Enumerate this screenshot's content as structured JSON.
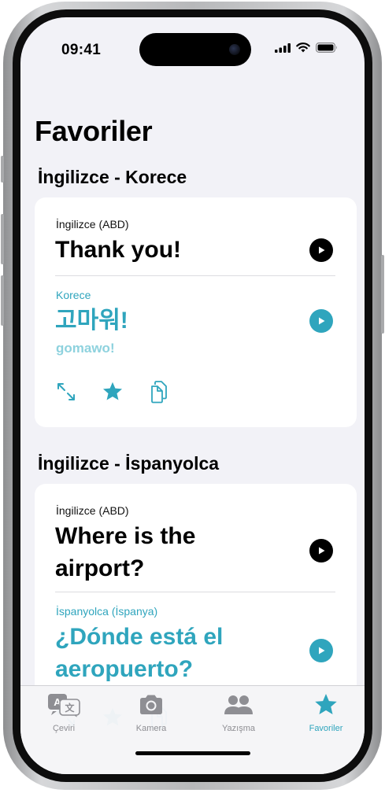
{
  "status_bar": {
    "time": "09:41"
  },
  "page": {
    "title": "Favoriler"
  },
  "favorites": [
    {
      "section_title": "İngilizce - Korece",
      "source_language": "İngilizce (ABD)",
      "source_text": "Thank you!",
      "target_language": "Korece",
      "target_text": "고마워!",
      "transliteration": "gomawo!"
    },
    {
      "section_title": "İngilizce - İspanyolca",
      "source_language": "İngilizce (ABD)",
      "source_text": "Where is the airport?",
      "target_language": "İspanyolca (İspanya)",
      "target_text": "¿Dónde está el aeropuerto?"
    }
  ],
  "tab_bar": {
    "items": [
      {
        "label": "Çeviri",
        "icon": "translate-icon"
      },
      {
        "label": "Kamera",
        "icon": "camera-icon"
      },
      {
        "label": "Yazışma",
        "icon": "conversation-icon"
      },
      {
        "label": "Favoriler",
        "icon": "star-icon",
        "selected": true
      }
    ]
  },
  "colors": {
    "accent": "#2fa5bd",
    "background": "#f2f2f7",
    "card": "#ffffff"
  }
}
